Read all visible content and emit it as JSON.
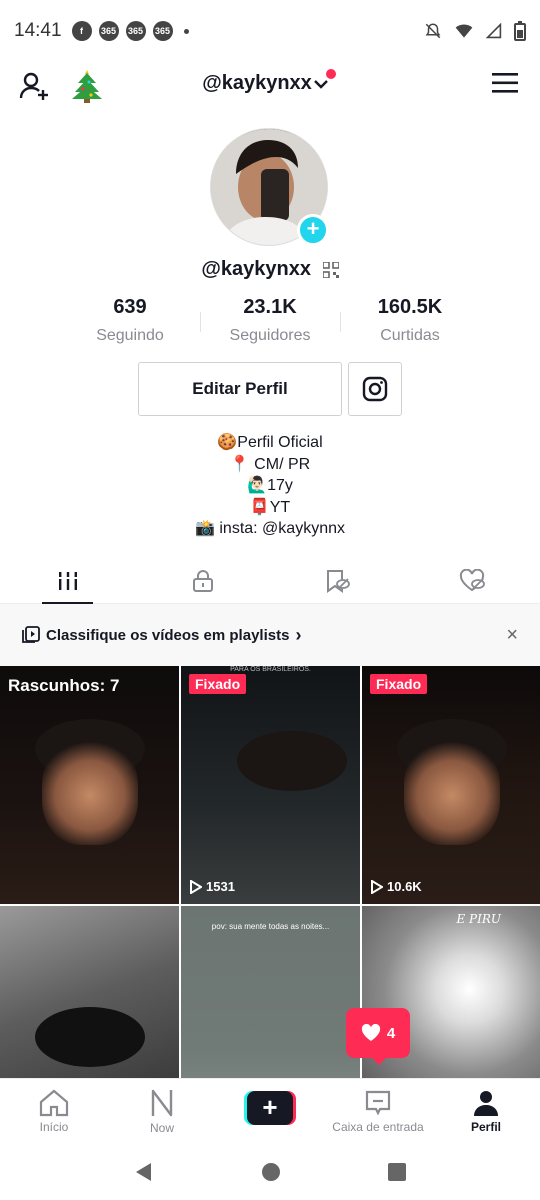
{
  "status_bar": {
    "time": "14:41",
    "icons": [
      "facebook-icon",
      "app-365-icon",
      "app-365-icon",
      "app-365-icon"
    ],
    "app_badge": "365"
  },
  "header": {
    "handle": "@kaykynxx",
    "has_notification_dot": true,
    "accent_color": "#fe2c55"
  },
  "profile": {
    "username": "@kaykynxx",
    "stats": [
      {
        "value": "639",
        "label": "Seguindo"
      },
      {
        "value": "23.1K",
        "label": "Seguidores"
      },
      {
        "value": "160.5K",
        "label": "Curtidas"
      }
    ],
    "edit_label": "Editar Perfil",
    "bio": [
      "🍪Perfil Oficial",
      "📍 CM/ PR",
      "🙋🏻‍♂️17y",
      "📮YT",
      "📸 insta: @kaykynnx"
    ]
  },
  "tabs": [
    "videos-tab",
    "private-tab",
    "saved-tab",
    "liked-tab"
  ],
  "playlist_banner": {
    "text": "Classifique os vídeos em playlists",
    "chevron": "›",
    "close": "×"
  },
  "grid": {
    "drafts_label": "Rascunhos: 7",
    "pinned_label": "Fixado",
    "tiles": [
      {
        "views": ""
      },
      {
        "views": "1531",
        "caption": "PARA OS BRASILEIROS."
      },
      {
        "views": "10.6K"
      },
      {
        "views": ""
      },
      {
        "views": "",
        "caption": "pov: sua mente todas as noites..."
      },
      {
        "views": "",
        "caption": "E PIRU"
      }
    ]
  },
  "like_badge": {
    "count": "4"
  },
  "bottom_nav": [
    {
      "label": "Início"
    },
    {
      "label": "Now"
    },
    {
      "label": ""
    },
    {
      "label": "Caixa de entrada"
    },
    {
      "label": "Perfil"
    }
  ]
}
